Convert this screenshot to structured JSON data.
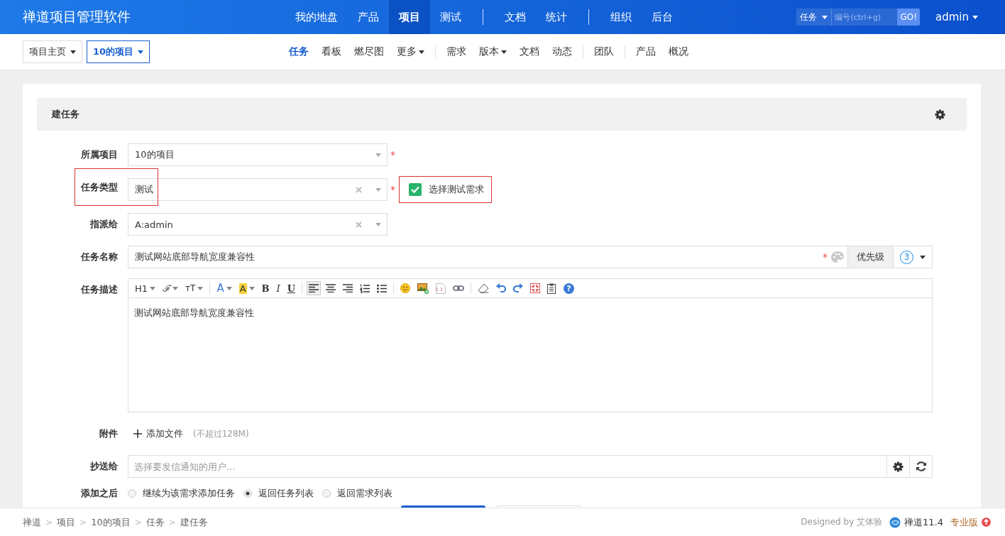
{
  "app_title": "禅道项目管理软件",
  "required_mark": "*",
  "main_nav": [
    {
      "label": "我的地盘",
      "selected": false,
      "divider_before": false
    },
    {
      "label": "产品",
      "selected": false,
      "divider_before": false
    },
    {
      "label": "项目",
      "selected": true,
      "divider_before": false
    },
    {
      "label": "测试",
      "selected": false,
      "divider_before": false
    },
    {
      "label": "文档",
      "selected": false,
      "divider_before": true
    },
    {
      "label": "统计",
      "selected": false,
      "divider_before": false
    },
    {
      "label": "组织",
      "selected": false,
      "divider_before": true
    },
    {
      "label": "后台",
      "selected": false,
      "divider_before": false
    }
  ],
  "quick_search": {
    "type": "任务",
    "placeholder": "编号(ctrl+g)",
    "go": "GO!"
  },
  "user": "admin",
  "project_crumbs": [
    {
      "label": "项目主页",
      "selected": false
    },
    {
      "label": "10的项目",
      "selected": true
    }
  ],
  "sub_nav": [
    {
      "label": "任务",
      "selected": true,
      "dropdown": false,
      "divider_before": false
    },
    {
      "label": "看板",
      "selected": false,
      "dropdown": false,
      "divider_before": false
    },
    {
      "label": "燃尽图",
      "selected": false,
      "dropdown": false,
      "divider_before": false
    },
    {
      "label": "更多",
      "selected": false,
      "dropdown": true,
      "divider_before": false
    },
    {
      "label": "需求",
      "selected": false,
      "dropdown": false,
      "divider_before": true
    },
    {
      "label": "版本",
      "selected": false,
      "dropdown": true,
      "divider_before": false
    },
    {
      "label": "文档",
      "selected": false,
      "dropdown": false,
      "divider_before": false
    },
    {
      "label": "动态",
      "selected": false,
      "dropdown": false,
      "divider_before": false
    },
    {
      "label": "团队",
      "selected": false,
      "dropdown": false,
      "divider_before": true
    },
    {
      "label": "产品",
      "selected": false,
      "dropdown": false,
      "divider_before": true
    },
    {
      "label": "概况",
      "selected": false,
      "dropdown": false,
      "divider_before": false
    }
  ],
  "panel_title": "建任务",
  "fields": [
    {
      "kind": "select",
      "label": "所属项目",
      "value": "10的项目",
      "required": true,
      "clearable": false,
      "annotated": false
    },
    {
      "kind": "select",
      "label": "任务类型",
      "value": "测试",
      "required": true,
      "clearable": true,
      "annotated": true,
      "checkbox": {
        "label": "选择测试需求",
        "checked": true,
        "annotated": true
      }
    },
    {
      "kind": "select",
      "label": "指派给",
      "value": "A:admin",
      "required": false,
      "clearable": true,
      "annotated": false
    },
    {
      "kind": "name",
      "label": "任务名称",
      "value": "测试网站底部导航宽度兼容性",
      "required": true,
      "addon": "优先级",
      "priority": "3"
    },
    {
      "kind": "editor",
      "label": "任务描述",
      "value": "测试网站底部导航宽度兼容性",
      "toolbar": [
        {
          "kind": "heading",
          "label": "H1"
        },
        {
          "kind": "font",
          "label": "ℱ"
        },
        {
          "kind": "size",
          "label": "ᴛT"
        },
        {
          "kind": "separator"
        },
        {
          "kind": "color",
          "label": "A"
        },
        {
          "kind": "highlight",
          "label": "A"
        },
        {
          "kind": "bold",
          "label": "B"
        },
        {
          "kind": "italic",
          "label": "I"
        },
        {
          "kind": "underline",
          "label": "U"
        },
        {
          "kind": "separator"
        },
        {
          "kind": "align-left",
          "selected": true
        },
        {
          "kind": "align-center",
          "selected": false
        },
        {
          "kind": "align-right",
          "selected": false
        },
        {
          "kind": "ordered-list",
          "selected": false
        },
        {
          "kind": "bullet-list",
          "selected": false
        },
        {
          "kind": "separator"
        },
        {
          "kind": "emoji"
        },
        {
          "kind": "image"
        },
        {
          "kind": "code"
        },
        {
          "kind": "link"
        },
        {
          "kind": "separator"
        },
        {
          "kind": "eraser"
        },
        {
          "kind": "undo"
        },
        {
          "kind": "redo"
        },
        {
          "kind": "fullscreen"
        },
        {
          "kind": "paste"
        },
        {
          "kind": "help",
          "label": "?"
        }
      ]
    },
    {
      "kind": "files",
      "label": "附件",
      "action": "添加文件",
      "hint": "(不超过128M)"
    },
    {
      "kind": "users",
      "label": "抄送给",
      "placeholder": "选择要发信通知的用户..."
    },
    {
      "kind": "radios",
      "label": "添加之后",
      "options": [
        {
          "label": "继续为该需求添加任务",
          "selected": false
        },
        {
          "label": "返回任务列表",
          "selected": true
        },
        {
          "label": "返回需求列表",
          "selected": false
        }
      ]
    }
  ],
  "footer": {
    "crumbs": [
      "禅道",
      "项目",
      "10的项目",
      "任务",
      "建任务"
    ],
    "separator": ">",
    "designed_by": "Designed by 艾体验",
    "version": "禅道11.4",
    "edition": "专业版"
  }
}
